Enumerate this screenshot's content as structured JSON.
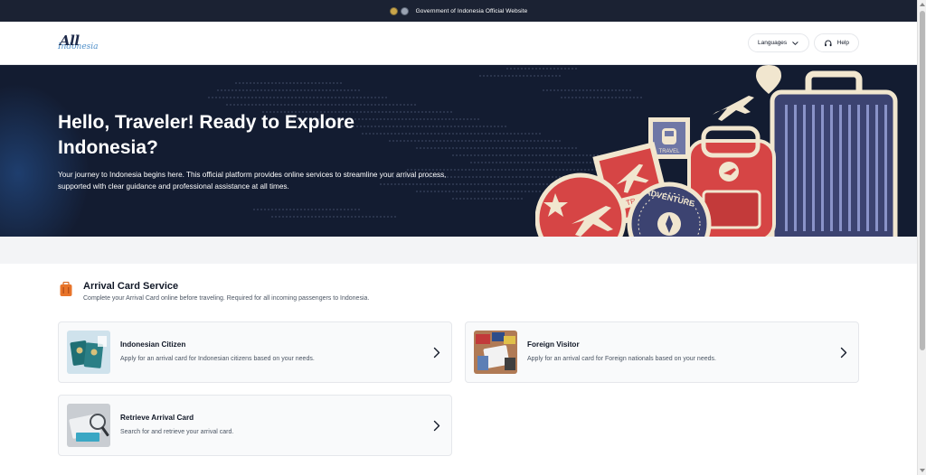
{
  "gov_banner": {
    "text": "Government of Indonesia Official Website",
    "icons": [
      "garuda-emblem-icon",
      "ministry-emblem-icon"
    ]
  },
  "header": {
    "logo": {
      "primary": "All",
      "secondary": "Indonesia"
    },
    "languages_label": "Languages",
    "help_label": "Help",
    "icons": {
      "languages": "chevron-down-icon",
      "help": "headset-icon"
    }
  },
  "hero": {
    "title": "Hello, Traveler! Ready to Explore Indonesia?",
    "description": "Your journey to Indonesia begins here. This official platform provides online services to streamline your arrival process, supported with clear guidance and professional assistance at all times.",
    "illustration": {
      "stamp_travel": "TRAVEL",
      "badge_adventure": "ADVENTURE"
    },
    "colors": {
      "background": "#131c31",
      "accent_red": "#d64545",
      "accent_cream": "#f1e6cf",
      "accent_navy": "#3c4371"
    }
  },
  "arrival_section": {
    "title": "Arrival Card Service",
    "subtitle": "Complete your Arrival Card online before traveling. Required for all incoming passengers to Indonesia.",
    "icon": "luggage-icon",
    "cards": [
      {
        "title": "Indonesian Citizen",
        "description": "Apply for an arrival card for Indonesian citizens based on your needs.",
        "icon": "passport-image"
      },
      {
        "title": "Foreign Visitor",
        "description": "Apply for an arrival card for Foreign nationals based on your needs.",
        "icon": "traveler-image"
      },
      {
        "title": "Retrieve Arrival Card",
        "description": "Search for and retrieve your arrival card.",
        "icon": "magnifier-image"
      }
    ]
  }
}
